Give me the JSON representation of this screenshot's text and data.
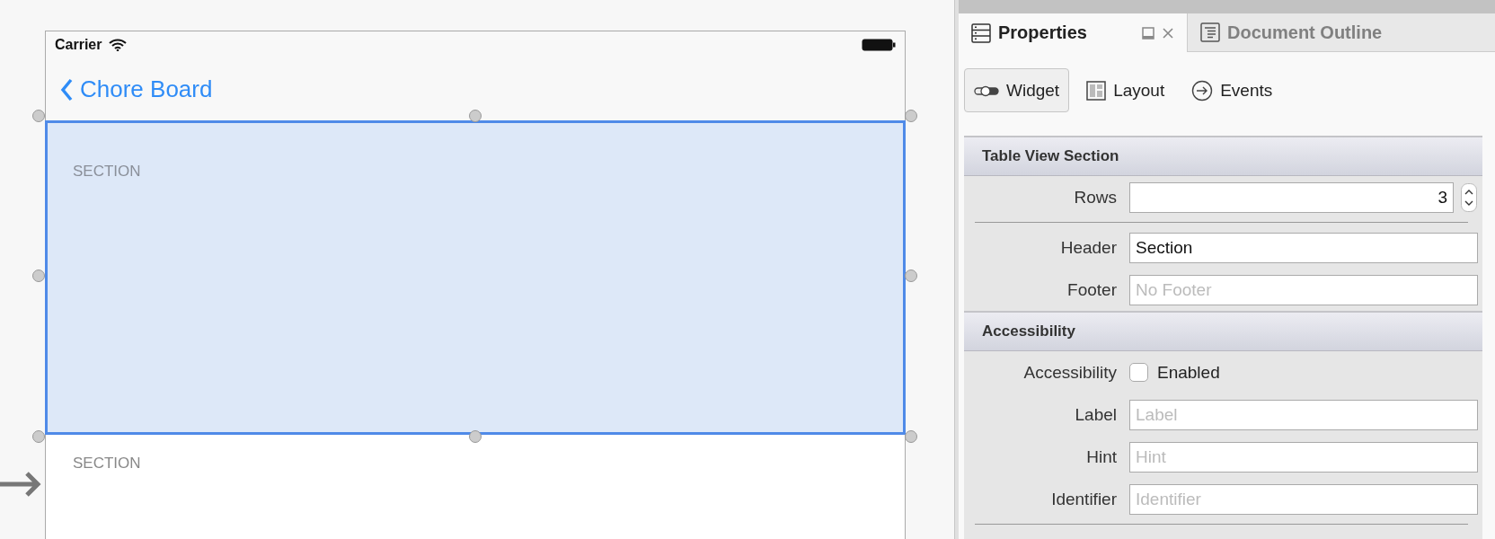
{
  "canvas": {
    "status_bar": {
      "carrier": "Carrier"
    },
    "nav_bar": {
      "back_title": "Chore Board"
    },
    "sections": [
      {
        "header": "SECTION",
        "selected": true
      },
      {
        "header": "SECTION",
        "selected": false
      }
    ]
  },
  "panel": {
    "tabs": [
      {
        "label": "Properties",
        "selected": true
      },
      {
        "label": "Document Outline",
        "selected": false
      }
    ],
    "modes": [
      {
        "label": "Widget",
        "selected": true
      },
      {
        "label": "Layout",
        "selected": false
      },
      {
        "label": "Events",
        "selected": false
      }
    ],
    "groups": [
      {
        "title": "Table View Section",
        "fields": [
          {
            "kind": "stepper",
            "label": "Rows",
            "value": "3"
          },
          {
            "kind": "text",
            "label": "Header",
            "value": "Section"
          },
          {
            "kind": "text",
            "label": "Footer",
            "placeholder": "No Footer"
          }
        ]
      },
      {
        "title": "Accessibility",
        "fields": [
          {
            "kind": "check",
            "label": "Accessibility",
            "text": "Enabled",
            "checked": false
          },
          {
            "kind": "text",
            "label": "Label",
            "placeholder": "Label"
          },
          {
            "kind": "text",
            "label": "Hint",
            "placeholder": "Hint"
          },
          {
            "kind": "text",
            "label": "Identifier",
            "placeholder": "Identifier"
          }
        ]
      }
    ]
  }
}
